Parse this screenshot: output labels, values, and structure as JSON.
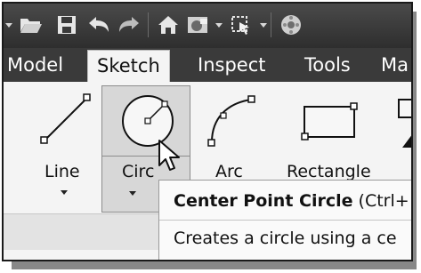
{
  "toolbar": {
    "icons": [
      "open-folder-icon",
      "save-icon",
      "undo-icon",
      "redo-icon",
      "home-icon",
      "materials-icon",
      "select-icon",
      "appearance-icon"
    ]
  },
  "tabs": [
    {
      "label": "Model"
    },
    {
      "label": "Sketch"
    },
    {
      "label": "Inspect"
    },
    {
      "label": "Tools"
    },
    {
      "label": "Ma"
    }
  ],
  "ribbon": {
    "line_label": "Line",
    "circle_label": "Circ",
    "arc_label": "Arc",
    "rectangle_label": "Rectangle"
  },
  "tooltip": {
    "title": "Center Point Circle",
    "shortcut": " (Ctrl+",
    "description": "Creates a circle using a ce"
  }
}
